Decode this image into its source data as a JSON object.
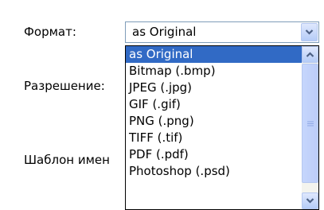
{
  "form": {
    "format_label": "Формат:",
    "resolution_label": "Разрешение:",
    "template_label": "Шаблон имен"
  },
  "format_select": {
    "value": "as Original",
    "options": [
      "as Original",
      "Bitmap (.bmp)",
      "JPEG (.jpg)",
      "GIF (.gif)",
      "PNG (.png)",
      "TIFF (.tif)",
      "PDF (.pdf)",
      "Photoshop (.psd)"
    ],
    "selected_index": 0
  },
  "icons": {
    "combo_arrow": "chevron-down-icon",
    "scroll_up": "chevron-up-icon",
    "scroll_down": "chevron-down-icon",
    "thumb_grip": "grip-icon"
  },
  "colors": {
    "selection": "#316ac5",
    "border": "#7f9db9",
    "button": "#c1d3fb"
  }
}
